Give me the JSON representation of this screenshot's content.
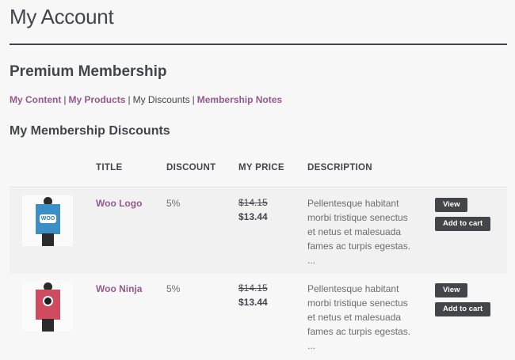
{
  "header": {
    "title": "My Account"
  },
  "membership": {
    "title": "Premium Membership"
  },
  "subnav": {
    "items": [
      {
        "label": "My Content"
      },
      {
        "label": "My Products"
      },
      {
        "label": "My Discounts"
      },
      {
        "label": "Membership Notes"
      }
    ],
    "separator": "|"
  },
  "section": {
    "title": "My Membership Discounts"
  },
  "table": {
    "columns": [
      "TITLE",
      "DISCOUNT",
      "MY PRICE",
      "DESCRIPTION"
    ],
    "rows": [
      {
        "name": "Woo Logo",
        "image_icon": "woo-logo-poster-icon",
        "image_mark_text": "WOO",
        "poster_color": "#3c8fc6",
        "discount": "5%",
        "old_price": "$14.15",
        "new_price": "$13.44",
        "description": "Pellentesque habitant morbi tristique senectus et netus et malesuada fames ac turpis egestas. ...",
        "view_label": "View",
        "cart_label": "Add to cart"
      },
      {
        "name": "Woo Ninja",
        "image_icon": "ninja-poster-icon",
        "poster_color": "#cf4b5f",
        "discount": "5%",
        "old_price": "$14.15",
        "new_price": "$13.44",
        "description": "Pellentesque habitant morbi tristique senectus et netus et malesuada fames ac turpis egestas. ...",
        "view_label": "View",
        "cart_label": "Add to cart"
      }
    ]
  },
  "colors": {
    "accent": "#96588a",
    "text": "#43454b",
    "button": "#43454b",
    "row_alt": "#f1f1f1"
  }
}
